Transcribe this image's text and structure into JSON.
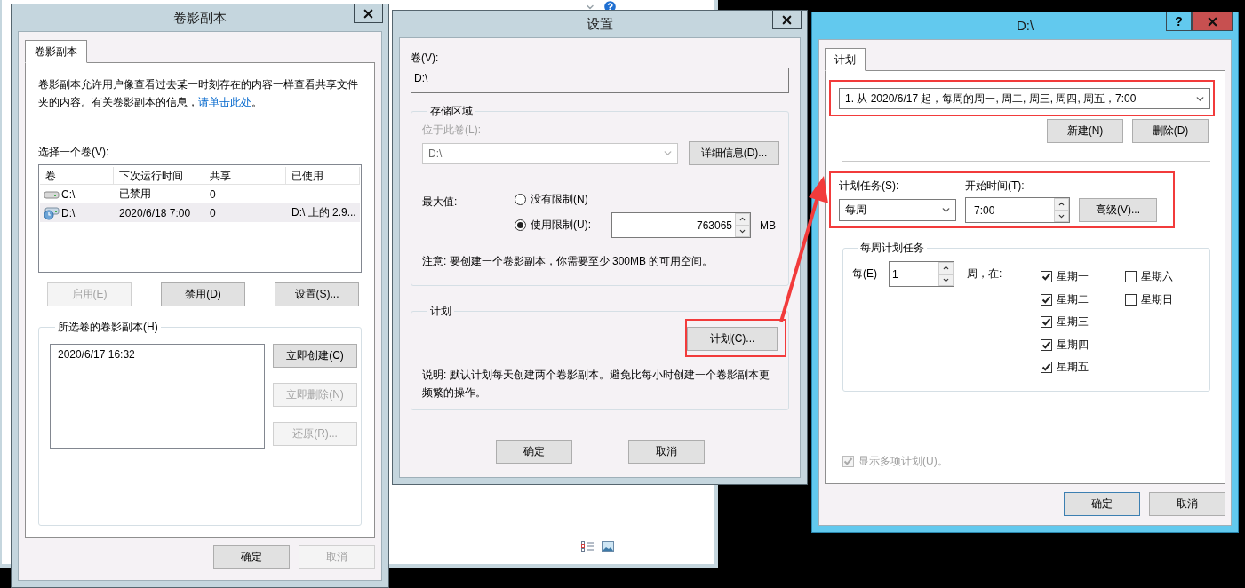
{
  "shadow_copies_window": {
    "title": "卷影副本",
    "tabs": [
      {
        "label": "卷影副本",
        "selected": true
      }
    ],
    "description": "卷影副本允许用户像查看过去某一时刻存在的内容一样查看共享文件夹的内容。有关卷影副本的信息，",
    "link": "请单击此处",
    "description_end": "。",
    "volume_label": "选择一个卷(V):",
    "volume_table": {
      "columns": [
        "卷",
        "下次运行时间",
        "共享",
        "已使用"
      ],
      "rows": [
        {
          "kind": "drive",
          "selected": false,
          "volume": "C:\\",
          "next_run": "已禁用",
          "shares": "0"
        },
        {
          "kind": "scheduled_drive",
          "selected": true,
          "volume": "D:\\",
          "next_run": "2020/6/18 7:00",
          "shares": "0",
          "used": "D:\\ 上的 2.9..."
        }
      ]
    },
    "volume_buttons": [
      {
        "label": "启用(E)",
        "disabled": true
      },
      {
        "label": "禁用(D)",
        "disabled": false
      },
      {
        "label": "设置(S)...",
        "disabled": false
      }
    ],
    "copies_group": {
      "title": "所选卷的卷影副本(H)",
      "copies": [
        "2020/6/17 16:32"
      ],
      "buttons": [
        {
          "label": "立即创建(C)",
          "disabled": false
        },
        {
          "label": "立即删除(N)",
          "disabled": true
        },
        {
          "label": "还原(R)...",
          "disabled": true
        }
      ]
    },
    "footer_buttons": [
      {
        "label": "确定",
        "disabled": false
      },
      {
        "label": "取消",
        "disabled": true
      }
    ]
  },
  "settings_window": {
    "title": "设置",
    "volume_label": "卷(V):",
    "volume_value": "D:\\",
    "storage_group": {
      "title": "存储区域",
      "location_label": "位于此卷(L):",
      "location_value": "D:\\",
      "location_disabled": true,
      "details_button": "详细信息(D)...",
      "max_label": "最大值:",
      "limit_options": [
        {
          "label": "没有限制(N)",
          "selected": false
        },
        {
          "label": "使用限制(U):",
          "selected": true
        }
      ],
      "limit_value": "763065",
      "unit": "MB",
      "note": "注意: 要创建一个卷影副本，你需要至少 300MB 的可用空间。"
    },
    "schedule_group": {
      "title": "计划",
      "schedule_button": {
        "label": "计划(C)...",
        "highlighted": true
      },
      "description": "说明: 默认计划每天创建两个卷影副本。避免比每小时创建一个卷影副本更频繁的操作。"
    },
    "footer_buttons": [
      "确定",
      "取消"
    ]
  },
  "schedule_window": {
    "title": "D:\\",
    "help_button": "?",
    "tabs": [
      {
        "label": "计划",
        "selected": true
      }
    ],
    "schedule_list": {
      "value": "1. 从 2020/6/17 起，每周的周一, 周二, 周三, 周四, 周五，7:00",
      "highlighted": true
    },
    "list_buttons": [
      "新建(N)",
      "删除(D)"
    ],
    "task_settings": {
      "highlighted": true,
      "task_label": "计划任务(S):",
      "task_value": "每周",
      "start_label": "开始时间(T):",
      "start_value": "7:00",
      "advanced_button": "高级(V)..."
    },
    "weekly_group": {
      "title": "每周计划任务",
      "every_label": "每(E)",
      "every_value": "1",
      "weeks_label": "周，在:",
      "days": [
        {
          "label": "星期一",
          "checked": true
        },
        {
          "label": "星期二",
          "checked": true
        },
        {
          "label": "星期三",
          "checked": true
        },
        {
          "label": "星期四",
          "checked": true
        },
        {
          "label": "星期五",
          "checked": true
        },
        {
          "label": "星期六",
          "checked": false
        },
        {
          "label": "星期日",
          "checked": false
        }
      ]
    },
    "show_multiple": {
      "label": "显示多项计划(U)。",
      "checked": true,
      "disabled": true
    },
    "footer_buttons": [
      {
        "label": "确定",
        "default": true
      },
      {
        "label": "取消",
        "default": false
      }
    ]
  }
}
